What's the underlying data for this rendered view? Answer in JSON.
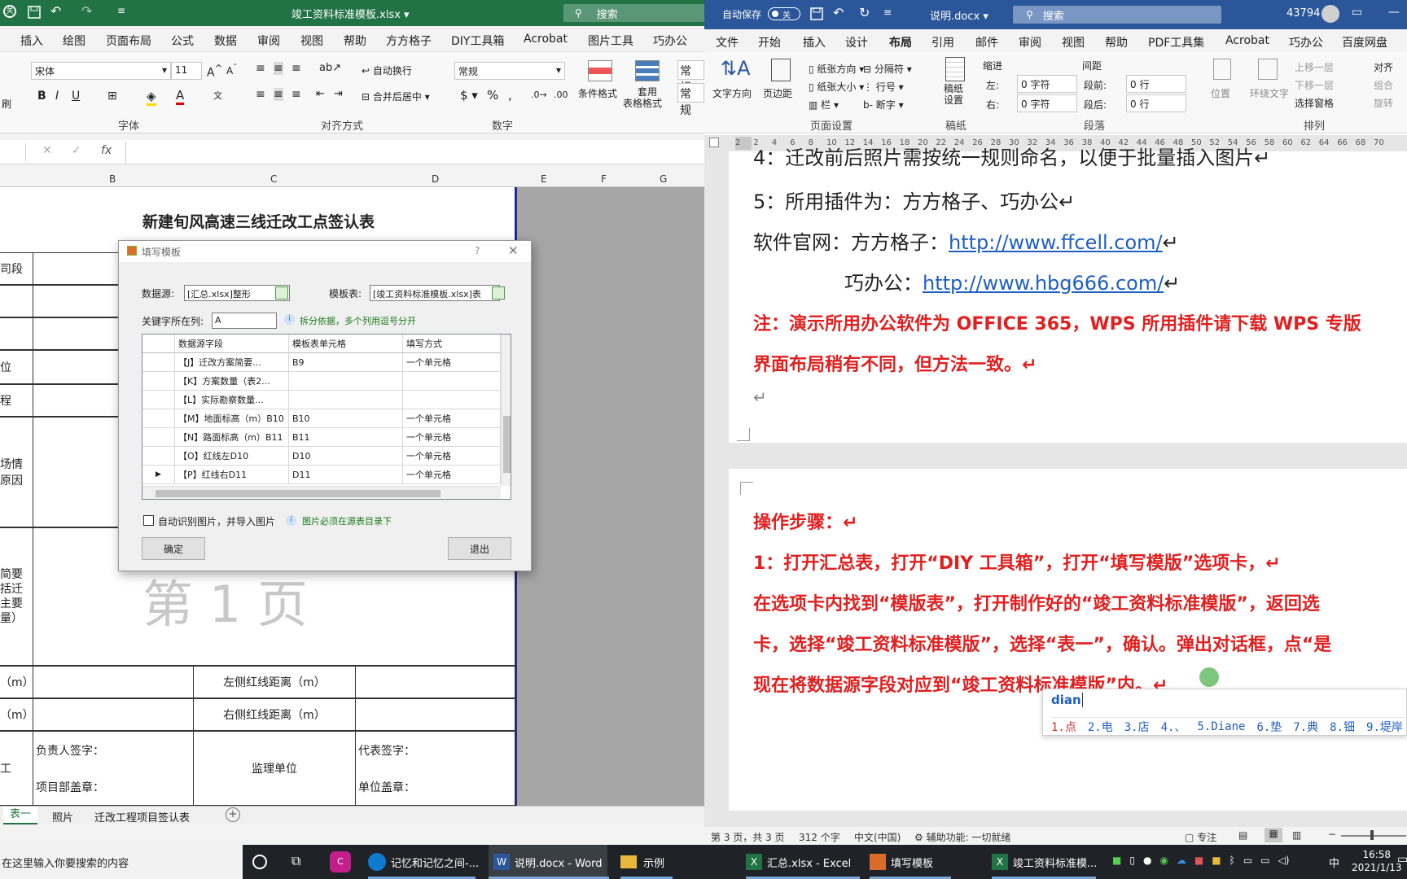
{
  "excel": {
    "title": "竣工资料标准模板.xlsx",
    "search_placeholder": "搜索",
    "tabs": [
      "插入",
      "绘图",
      "页面布局",
      "公式",
      "数据",
      "审阅",
      "视图",
      "帮助",
      "方方格子",
      "DIY工具箱",
      "Acrobat",
      "图片工具",
      "巧办公"
    ],
    "font_name": "宋体",
    "font_size": "11",
    "number_format": "常规",
    "group_font": "字体",
    "group_align": "对齐方式",
    "group_number": "数字",
    "wrap_text": "自动换行",
    "merge_center": "合并后居中",
    "cond_format": "条件格式",
    "table_format_1": "套用",
    "table_format_2": "表格格式",
    "style_1": "常规",
    "style_2": "常规",
    "left_label": "刷",
    "formula_fx": "fx",
    "columns": [
      "B",
      "C",
      "D",
      "E",
      "F",
      "G"
    ],
    "sheet_title": "新建旬风高速三线迁改工点签认表",
    "row_labels": [
      "司段",
      "",
      "",
      "位",
      "程",
      "场情\n原因",
      "简要\n括迁\n主要\n量）",
      "（m）",
      "（m）",
      "工"
    ],
    "page_watermark": "第 1 页",
    "left_redline": "左侧红线距离（m）",
    "right_redline": "右侧红线距离（m）",
    "sign_person": "负责人签字：",
    "sign_project": "项目部盖章：",
    "supervision": "监理单位",
    "rep_sign": "代表签字：",
    "unit_seal": "单位盖章：",
    "sheet_tabs": [
      "表一",
      "照片",
      "迁改工程项目签认表"
    ]
  },
  "dialog": {
    "title": "填写模板",
    "help": "?",
    "data_source_label": "数据源:",
    "data_source_value": "[汇总.xlsx]整形",
    "template_label": "模板表:",
    "template_value": "[竣工资料标准模板.xlsx]表",
    "key_col_label": "关键字所在列:",
    "key_col_value": "A",
    "split_hint": "拆分依据，多个列用逗号分开",
    "headers": [
      "数据源字段",
      "模板表单元格",
      "填写方式"
    ],
    "rows": [
      {
        "field": "【J】迁改方案简要...",
        "cell": "B9",
        "mode": "一个单元格"
      },
      {
        "field": "【K】方案数量（表2...",
        "cell": "",
        "mode": ""
      },
      {
        "field": "【L】实际勘察数量...",
        "cell": "",
        "mode": ""
      },
      {
        "field": "【M】地面标高（m）B10",
        "cell": "B10",
        "mode": "一个单元格"
      },
      {
        "field": "【N】路面标高（m）B11",
        "cell": "B11",
        "mode": "一个单元格"
      },
      {
        "field": "【O】红线左D10",
        "cell": "D10",
        "mode": "一个单元格"
      },
      {
        "field": "【P】红线右D11",
        "cell": "D11",
        "mode": "一个单元格"
      }
    ],
    "auto_image": "自动识别图片，并导入图片",
    "image_hint": "图片必须在源表目录下",
    "ok": "确定",
    "exit": "退出"
  },
  "word": {
    "autosave": "自动保存",
    "autosave_state": "关",
    "title": "说明.docx",
    "search_placeholder": "搜索",
    "user_id": "43794",
    "tabs": [
      "文件",
      "开始",
      "插入",
      "设计",
      "布局",
      "引用",
      "邮件",
      "审阅",
      "视图",
      "帮助",
      "PDF工具集",
      "Acrobat",
      "巧办公",
      "百度网盘"
    ],
    "active_tab": "布局",
    "text_direction": "文字方向",
    "margins": "页边距",
    "orientation": "纸张方向",
    "size": "纸张大小",
    "columns": "栏",
    "breaks": "分隔符",
    "line_numbers": "行号",
    "hyphenation": "断字",
    "group_page_setup": "页面设置",
    "draft_paper": "稿纸\n设置",
    "group_draft": "稿纸",
    "indent": "缩进",
    "spacing": "间距",
    "left_label": "左:",
    "left_value": "0 字符",
    "right_label": "右:",
    "right_value": "0 字符",
    "before_label": "段前:",
    "before_value": "0 行",
    "after_label": "段后:",
    "after_value": "0 行",
    "group_paragraph": "段落",
    "position": "位置",
    "wrap": "环绕文字",
    "bring_forward": "上移一层",
    "send_backward": "下移一层",
    "selection_pane": "选择窗格",
    "align": "对齐",
    "group_obj": "组合",
    "rotate": "旋转",
    "group_arrange": "排列",
    "ruler_nums": [
      "2",
      "2",
      "4",
      "6",
      "8",
      "10",
      "12",
      "14",
      "16",
      "18",
      "20",
      "22",
      "24",
      "26",
      "28",
      "30",
      "32",
      "34",
      "36",
      "38",
      "40",
      "42",
      "44",
      "46",
      "48",
      "50",
      "52",
      "54",
      "56",
      "58",
      "60",
      "62",
      "64",
      "66",
      "68",
      "70"
    ],
    "line_4": "4：迁改前后照片需按统一规则命名，以便于批量插入图片↵",
    "line_5": "5：所用插件为：方方格子、巧办公↵",
    "site_label": "软件官网：方方格子：",
    "site_url_1": "http://www.ffcell.com/",
    "site_label_2": "巧办公：",
    "site_url_2": "http://www.hbg666.com/",
    "note_1": "注：演示所用办公软件为 OFFICE 365，WPS 所用插件请下载 WPS 专版",
    "note_2": "界面布局稍有不同，但方法一致。↵",
    "return_mark": "↵",
    "steps_title": "操作步骤：↵",
    "step_1": "1：打开汇总表，打开“DIY 工具箱”，打开“填写模版”选项卡，↵",
    "step_2": "在选项卡内找到“模版表”，打开制作好的“竣工资料标准模版”，返回选",
    "step_3": "卡，选择“竣工资料标准模版”，选择“表一”，确认。弹出对话框，点“是",
    "step_4": "现在将数据源字段对应到“竣工资料标准模版”内。↵",
    "status_page": "第 3 页，共 3 页",
    "status_words": "312 个字",
    "status_lang": "中文(中国)",
    "status_access": "辅助功能: 一切就绪",
    "status_focus": "专注"
  },
  "ime": {
    "input": "dian",
    "candidates": [
      "1.点",
      "2.电",
      "3.店",
      "4.、",
      "5.Diane",
      "6.垫",
      "7.典",
      "8.钿",
      "9.堤岸"
    ]
  },
  "taskbar": {
    "search_placeholder": "在这里输入你要搜索的内容",
    "apps": [
      "记忆和记忆之间-...",
      "说明.docx - Word",
      "示例",
      "汇总.xlsx - Excel",
      "填写模板",
      "竣工资料标准模..."
    ],
    "ime_lang": "中",
    "time": "16:58",
    "date": "2021/1/13"
  },
  "colors": {
    "excel_green": "#217346",
    "word_blue": "#2b579a",
    "red_text": "#e02020",
    "link_blue": "#1f5fbf"
  }
}
